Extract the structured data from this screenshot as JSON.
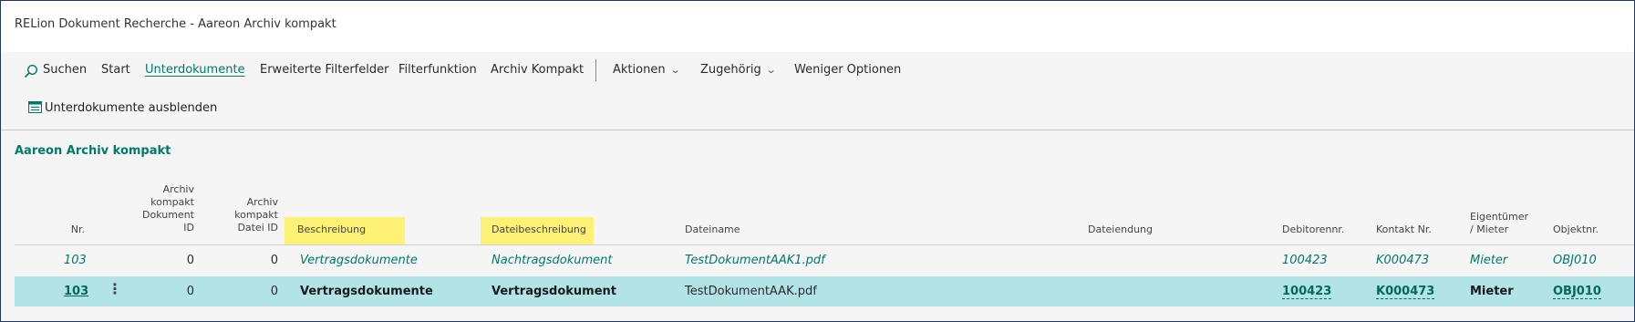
{
  "window": {
    "title": "RELion Dokument Recherche - Aareon Archiv kompakt"
  },
  "actions": {
    "search": "Suchen",
    "start": "Start",
    "unterdokumente": "Unterdokumente",
    "erweiterte": "Erweiterte Filterfelder",
    "filterfunktion": "Filterfunktion",
    "archiv": "Archiv Kompakt",
    "aktionen": "Aktionen",
    "zugehoerig": "Zugehörig",
    "weniger": "Weniger Optionen"
  },
  "sub_action": {
    "label": "Unterdokumente ausblenden"
  },
  "section": {
    "title": "Aareon Archiv kompakt"
  },
  "columns": {
    "nr": "Nr.",
    "dok_id": [
      "Archiv",
      "kompakt",
      "Dokument",
      "ID"
    ],
    "datei_id": [
      "Archiv",
      "kompakt",
      "Datei ID"
    ],
    "beschreibung": "Beschreibung",
    "dateibeschreibung": "Dateibeschreibung",
    "dateiname": "Dateiname",
    "dateiendung": "Dateiendung",
    "debitorennr": "Debitorennr.",
    "kontakt": "Kontakt Nr.",
    "eigentuemer": [
      "Eigentümer",
      "/ Mieter"
    ],
    "objektnr": "Objektnr."
  },
  "rows": [
    {
      "nr": "103",
      "dok_id": "0",
      "datei_id": "0",
      "beschreibung": "Vertragsdokumente",
      "dateibeschreibung": "Nachtragsdokument",
      "dateiname": "TestDokumentAAK1.pdf",
      "dateiendung": "",
      "debitorennr": "100423",
      "kontakt": "K000473",
      "eigentuemer": "Mieter",
      "objektnr": "OBJ010"
    },
    {
      "nr": "103",
      "dok_id": "0",
      "datei_id": "0",
      "beschreibung": "Vertragsdokumente",
      "dateibeschreibung": "Vertragsdokument",
      "dateiname": "TestDokumentAAK.pdf",
      "dateiendung": "",
      "debitorennr": "100423",
      "kontakt": "K000473",
      "eigentuemer": "Mieter",
      "objektnr": "OBJ010"
    }
  ],
  "colors": {
    "accent": "#00796b",
    "selected_row": "#b2e3e6",
    "highlight": "#fff176",
    "frame": "#1f3864"
  }
}
